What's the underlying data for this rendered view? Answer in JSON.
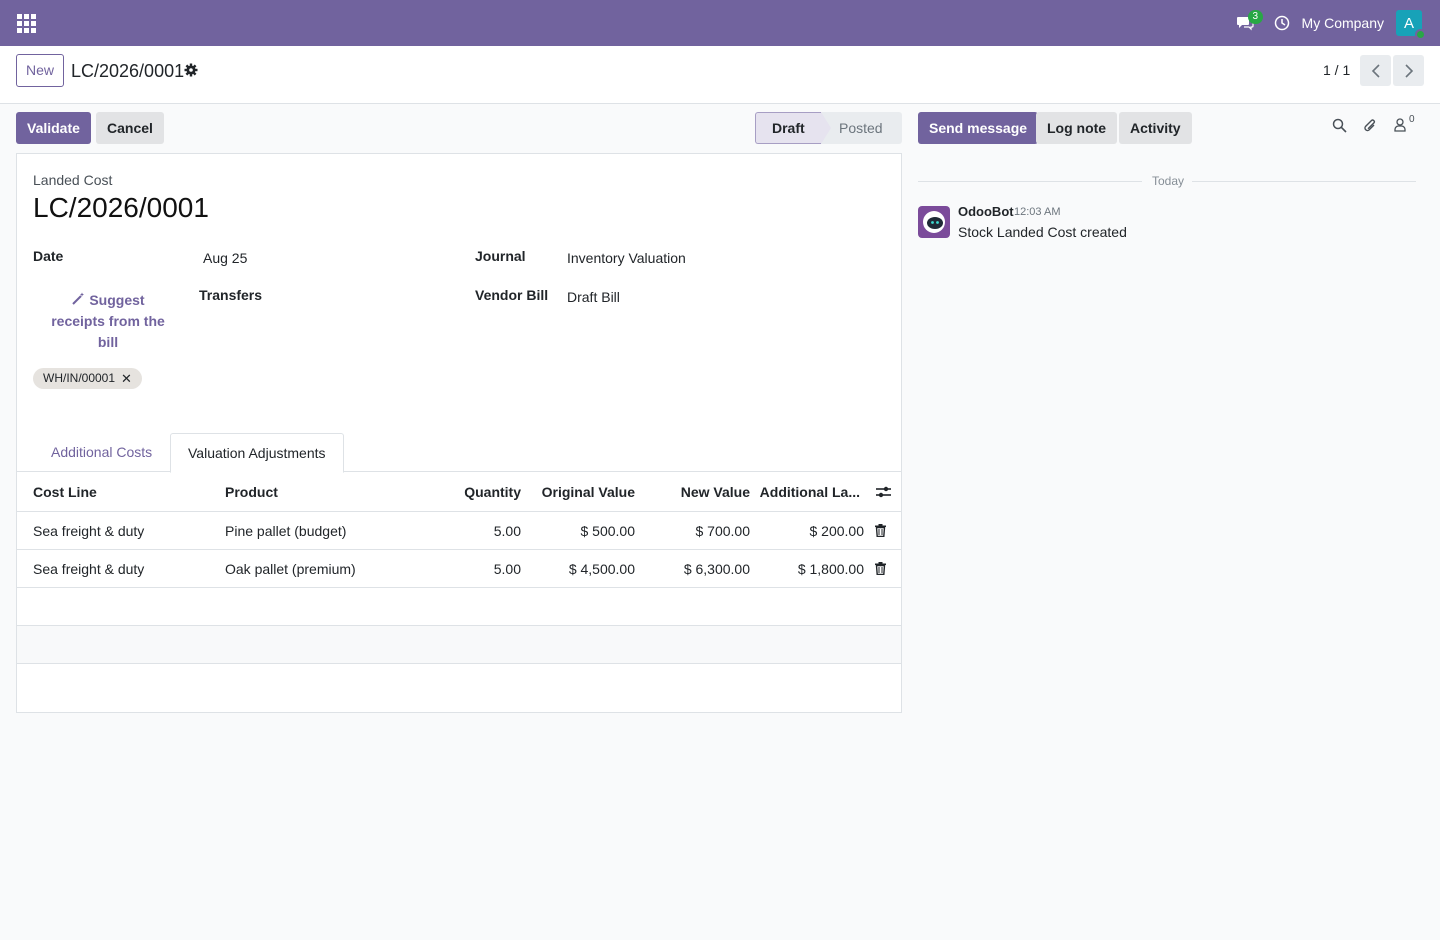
{
  "nav": {
    "company": "My Company",
    "message_count": "3",
    "avatar_letter": "A",
    "icons": [
      "apps-grid-icon",
      "chat-icon",
      "clock-icon"
    ],
    "accent": "#71639e"
  },
  "control": {
    "new_label": "New",
    "breadcrumb": "LC/2026/0001",
    "pager": "1 / 1"
  },
  "actions": {
    "validate": "Validate",
    "cancel": "Cancel"
  },
  "statusbar": {
    "states": [
      "Draft",
      "Posted"
    ],
    "current": "Draft"
  },
  "form": {
    "type_label": "Landed Cost",
    "name": "LC/2026/0001",
    "date_label": "Date",
    "date_value": "Aug 25",
    "journal_label": "Journal",
    "journal_value": "Inventory Valuation",
    "suggest_label": "Suggest receipts from the bill",
    "transfers_label": "Transfers",
    "vendor_bill_label": "Vendor Bill",
    "vendor_bill_value": "Draft Bill",
    "transfer_tags": [
      "WH/IN/00001"
    ]
  },
  "tabs": [
    {
      "label": "Additional Costs",
      "active": false
    },
    {
      "label": "Valuation Adjustments",
      "active": true
    }
  ],
  "table": {
    "columns": [
      "Cost Line",
      "Product",
      "Quantity",
      "Original Value",
      "New Value",
      "Additional La..."
    ],
    "rows": [
      {
        "cost_line": "Sea freight & duty",
        "product": "Pine pallet (budget)",
        "quantity": "5.00",
        "original_value": "$ 500.00",
        "new_value": "$ 700.00",
        "additional": "$ 200.00"
      },
      {
        "cost_line": "Sea freight & duty",
        "product": "Oak pallet (premium)",
        "quantity": "5.00",
        "original_value": "$ 4,500.00",
        "new_value": "$ 6,300.00",
        "additional": "$ 1,800.00"
      }
    ]
  },
  "chatter": {
    "send_message": "Send message",
    "log_note": "Log note",
    "activity": "Activity",
    "follower_count": "0",
    "date_separator": "Today",
    "messages": [
      {
        "author": "OdooBot",
        "time": "12:03 AM",
        "body": "Stock Landed Cost created"
      }
    ]
  }
}
